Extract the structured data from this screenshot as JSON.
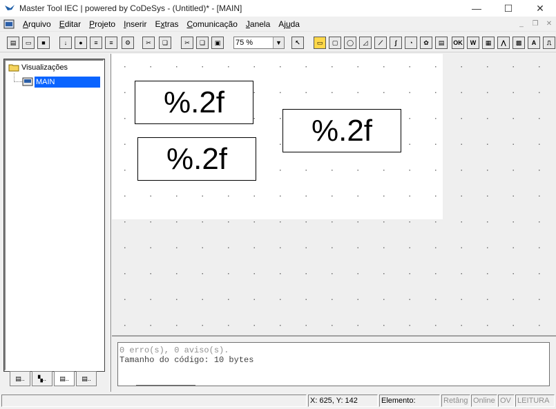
{
  "window": {
    "title": "Master Tool IEC | powered by CoDeSys - (Untitled)* - [MAIN]",
    "minimize": "—",
    "maximize": "☐",
    "close": "✕"
  },
  "menu": {
    "items": [
      {
        "prefix": "",
        "ul": "A",
        "rest": "rquivo"
      },
      {
        "prefix": "",
        "ul": "E",
        "rest": "ditar"
      },
      {
        "prefix": "",
        "ul": "P",
        "rest": "rojeto"
      },
      {
        "prefix": "",
        "ul": "I",
        "rest": "nserir"
      },
      {
        "prefix": "E",
        "ul": "x",
        "rest": "tras"
      },
      {
        "prefix": "",
        "ul": "C",
        "rest": "omunicação"
      },
      {
        "prefix": "",
        "ul": "J",
        "rest": "anela"
      },
      {
        "prefix": "Aj",
        "ul": "u",
        "rest": "da"
      }
    ],
    "mdi_minimize": "_",
    "mdi_restore": "❐",
    "mdi_close": "✕"
  },
  "toolbar": {
    "zoom_value": "75 %",
    "zoom_arrow": "▼",
    "buttons": [
      {
        "name": "new-file-icon",
        "glyph": "▤"
      },
      {
        "name": "open-file-icon",
        "glyph": "▭"
      },
      {
        "name": "save-icon",
        "glyph": "■"
      },
      {
        "name": "login-icon",
        "glyph": "↓"
      },
      {
        "name": "stop-icon",
        "glyph": "●"
      },
      {
        "name": "online-icon",
        "glyph": "≡"
      },
      {
        "name": "download-icon",
        "glyph": "≡"
      },
      {
        "name": "build-icon",
        "glyph": "⚙"
      },
      {
        "name": "cut-icon",
        "glyph": "✂"
      },
      {
        "name": "copy-icon",
        "glyph": "❏"
      },
      {
        "name": "cut2-icon",
        "glyph": "✂"
      },
      {
        "name": "copy2-icon",
        "glyph": "❏"
      },
      {
        "name": "paste-icon",
        "glyph": "▣"
      },
      {
        "name": "select-pointer-icon",
        "glyph": "↖"
      },
      {
        "name": "rectangle-icon",
        "glyph": "▭"
      },
      {
        "name": "rounded-rect-icon",
        "glyph": "▢"
      },
      {
        "name": "ellipse-icon",
        "glyph": "◯"
      },
      {
        "name": "polygon-icon",
        "glyph": "◿"
      },
      {
        "name": "polyline-icon",
        "glyph": "⟋"
      },
      {
        "name": "curve-icon",
        "glyph": "∫"
      },
      {
        "name": "pie-icon",
        "glyph": "◔"
      },
      {
        "name": "bitmap-icon",
        "glyph": "✿"
      },
      {
        "name": "visualization-icon",
        "glyph": "▤"
      },
      {
        "name": "button-icon",
        "glyph": "OK"
      },
      {
        "name": "wmf-icon",
        "glyph": "W"
      },
      {
        "name": "table-icon",
        "glyph": "▦"
      },
      {
        "name": "trend-icon",
        "glyph": "⋀"
      },
      {
        "name": "grid-icon",
        "glyph": "▩"
      },
      {
        "name": "activex-icon",
        "glyph": "A"
      },
      {
        "name": "scroll-icon",
        "glyph": "⎍"
      }
    ]
  },
  "tree": {
    "root_label": "Visualizações",
    "child_label": "MAIN"
  },
  "left_tabs": [
    "▤..",
    "▚..",
    "▤..",
    "▤.."
  ],
  "canvas": {
    "elements": [
      "%.2f",
      "%.2f",
      "%.2f"
    ]
  },
  "messages": {
    "line1": "0 erro(s), 0 aviso(s).",
    "line2": "Tamanho do código: 10 bytes"
  },
  "status": {
    "coords": "X:   625, Y:   142",
    "element_label": "Elemento:",
    "element_value": "",
    "rect": "Retâng",
    "online": "Online",
    "ov": "OV",
    "read": "LEITURA"
  },
  "colors": {
    "selection": "#0a64ff",
    "canvas_bg": "#efefef",
    "page_area": "#ffffff"
  }
}
